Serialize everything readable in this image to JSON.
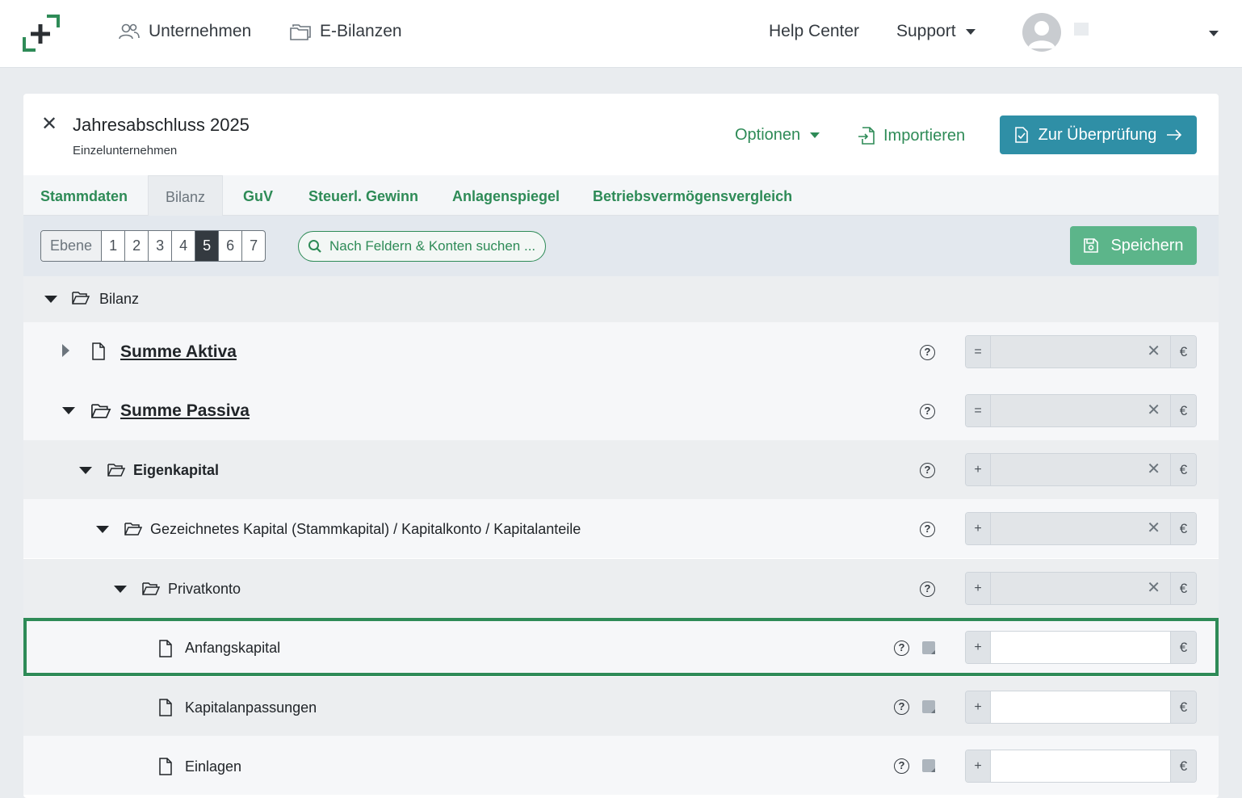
{
  "nav": {
    "companies": "Unternehmen",
    "ebilanzen": "E-Bilanzen",
    "help_center": "Help Center",
    "support": "Support"
  },
  "header": {
    "title": "Jahresabschluss 2025",
    "subtitle": "Einzelunternehmen",
    "options": "Optionen",
    "import": "Importieren",
    "review": "Zur Überprüfung"
  },
  "tabs": [
    "Stammdaten",
    "Bilanz",
    "GuV",
    "Steuerl. Gewinn",
    "Anlagenspiegel",
    "Betriebsvermögensvergleich"
  ],
  "active_tab": "Bilanz",
  "toolbar": {
    "level_label": "Ebene",
    "levels": [
      "1",
      "2",
      "3",
      "4",
      "5",
      "6",
      "7"
    ],
    "active_level": "5",
    "search_placeholder": "Nach Feldern & Konten suchen ...",
    "save": "Speichern"
  },
  "tree": {
    "root": "Bilanz",
    "rows": [
      {
        "label": "Summe Aktiva",
        "operator": "=",
        "currency": "€"
      },
      {
        "label": "Summe Passiva",
        "operator": "=",
        "currency": "€"
      },
      {
        "label": "Eigenkapital",
        "operator": "+",
        "currency": "€"
      },
      {
        "label": "Gezeichnetes Kapital (Stammkapital) / Kapitalkonto / Kapitalanteile",
        "operator": "+",
        "currency": "€"
      },
      {
        "label": "Privatkonto",
        "operator": "+",
        "currency": "€"
      },
      {
        "label": "Anfangskapital",
        "operator": "+",
        "currency": "€"
      },
      {
        "label": "Kapitalanpassungen",
        "operator": "+",
        "currency": "€"
      },
      {
        "label": "Einlagen",
        "operator": "+",
        "currency": "€"
      }
    ]
  },
  "colors": {
    "brand_green": "#2e8b57",
    "review_blue": "#2f8fa6",
    "save_green": "#5cb58a"
  }
}
